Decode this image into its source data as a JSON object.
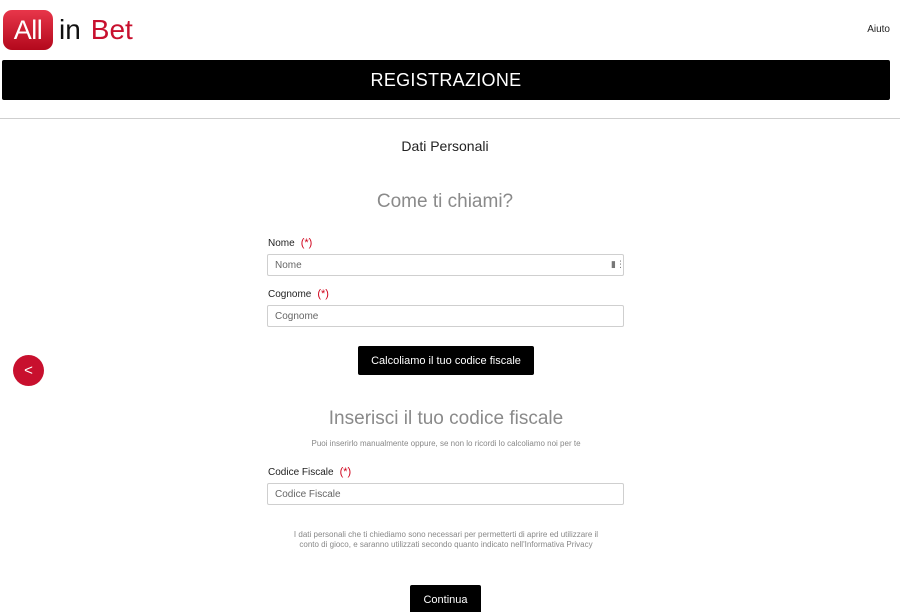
{
  "header": {
    "logo_box": "All",
    "logo_in": "in",
    "logo_bet": "Bet",
    "help_link": "Aiuto"
  },
  "page_title": "REGISTRAZIONE",
  "section_label": "Dati Personali",
  "question": "Come ti chiami?",
  "fields": {
    "nome": {
      "label": "Nome",
      "required_mark": "(*)",
      "placeholder": "Nome",
      "value": ""
    },
    "cognome": {
      "label": "Cognome",
      "required_mark": "(*)",
      "placeholder": "Cognome",
      "value": ""
    },
    "codice_fiscale": {
      "label": "Codice Fiscale",
      "required_mark": "(*)",
      "placeholder": "Codice Fiscale",
      "value": ""
    }
  },
  "buttons": {
    "calculate": "Calcoliamo il tuo codice fiscale",
    "continue": "Continua",
    "back": "<"
  },
  "tax_code_heading": "Inserisci il tuo codice fiscale",
  "tax_code_hint": "Puoi inserirlo manualmente oppure, se non lo ricordi lo calcoliamo noi per te",
  "privacy_note": "I dati personali che ti chiediamo sono necessari per permetterti di aprire ed utilizzare il conto di gioco, e saranno utilizzati secondo quanto indicato nell'Informativa Privacy",
  "icons": {
    "autofill": "autofill-key-icon",
    "back": "chevron-left-icon"
  },
  "colors": {
    "brand_red": "#c8102e",
    "title_bar": "#000000",
    "required": "#d0021b"
  }
}
